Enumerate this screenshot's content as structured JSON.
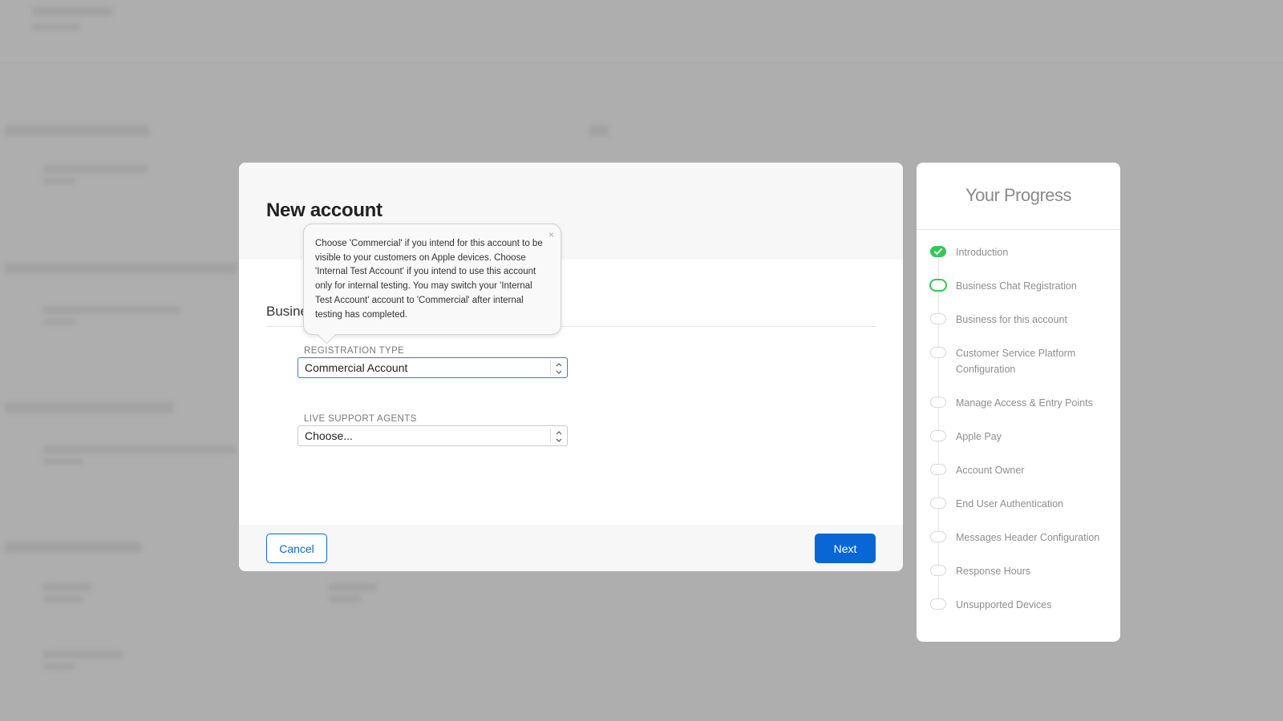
{
  "modal": {
    "title": "New account",
    "section_title": "Business Chat Registration",
    "fields": [
      {
        "label": "REGISTRATION TYPE",
        "value": "Commercial Account"
      },
      {
        "label": "LIVE SUPPORT AGENTS",
        "value": "Choose..."
      }
    ],
    "cancel_label": "Cancel",
    "next_label": "Next"
  },
  "tooltip": {
    "text": "Choose 'Commercial' if you intend for this account to be visible to your customers on Apple devices. Choose 'Internal Test Account' if you intend to use this account only for internal testing. You may switch your 'Internal Test Account' account to 'Commercial' after internal testing has completed.",
    "close_glyph": "×"
  },
  "progress": {
    "title": "Your Progress",
    "steps": [
      {
        "label": "Introduction",
        "state": "done"
      },
      {
        "label": "Business Chat Registration",
        "state": "current"
      },
      {
        "label": "Business for this account",
        "state": "pending"
      },
      {
        "label": "Customer Service Platform Configuration",
        "state": "pending"
      },
      {
        "label": "Manage Access & Entry Points",
        "state": "pending"
      },
      {
        "label": "Apple Pay",
        "state": "pending"
      },
      {
        "label": "Account Owner",
        "state": "pending"
      },
      {
        "label": "End User Authentication",
        "state": "pending"
      },
      {
        "label": "Messages Header Configuration",
        "state": "pending"
      },
      {
        "label": "Response Hours",
        "state": "pending"
      },
      {
        "label": "Unsupported Devices",
        "state": "pending"
      }
    ]
  },
  "colors": {
    "accent": "#0a66d4",
    "done": "#34c759",
    "overlay": "#aeaeae"
  }
}
